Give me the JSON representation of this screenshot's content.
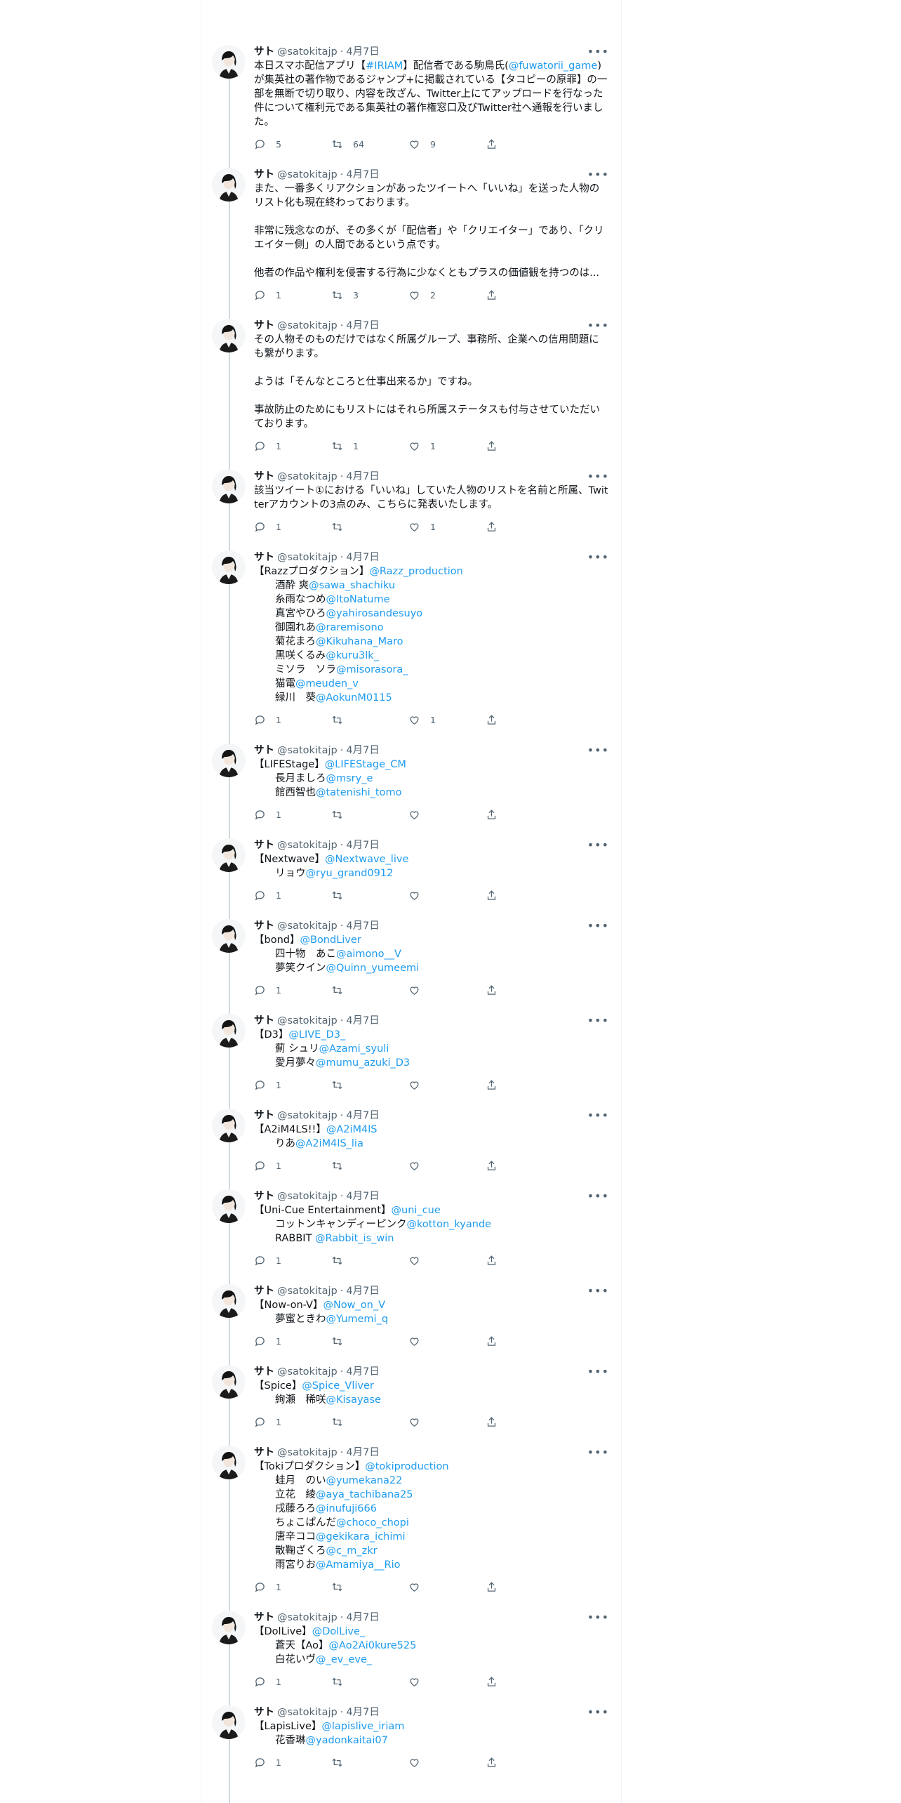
{
  "user": {
    "name": "サト",
    "handle": "@satokitajp",
    "dot": "·",
    "date": "4月7日"
  },
  "more_glyph": "•••",
  "tweets": [
    {
      "text": [
        [
          {
            "t": "本日スマホ配信アプリ【"
          },
          {
            "t": "#IRIAM",
            "link": true
          },
          {
            "t": "】配信者である駒鳥氏("
          },
          {
            "t": "@fuwatorii_game",
            "link": true
          },
          {
            "t": ")が集英社の著作物であるジャンプ+に掲載されている【タコピーの原罪】の一部を無断で切り取り、内容を改ざん、Twitter上にてアップロードを行なった件について権利元である集英社の著作権窓口及びTwitter社へ通報を行いました。"
          }
        ]
      ],
      "counts": {
        "reply": "5",
        "retweet": "64",
        "like": "9"
      }
    },
    {
      "text": [
        [
          {
            "t": "また、一番多くリアクションがあったツイートへ「いいね」を送った人物のリスト化も現在終わっております。"
          }
        ],
        [
          {
            "t": "非常に残念なのが、その多くが「配信者」や「クリエイター」であり、「クリエイター側」の人間であるという点です。"
          }
        ],
        [
          {
            "t": "他者の作品や権利を侵害する行為に少なくともプラスの価値観を持つのは..."
          }
        ]
      ],
      "counts": {
        "reply": "1",
        "retweet": "3",
        "like": "2"
      }
    },
    {
      "text": [
        [
          {
            "t": "その人物そのものだけではなく所属グループ、事務所、企業への信用問題にも繋がります。"
          }
        ],
        [
          {
            "t": "ようは「そんなところと仕事出来るか」ですね。"
          }
        ],
        [
          {
            "t": "事故防止のためにもリストにはそれら所属ステータスも付与させていただいております。"
          }
        ]
      ],
      "counts": {
        "reply": "1",
        "retweet": "1",
        "like": "1"
      }
    },
    {
      "text": [
        [
          {
            "t": "該当ツイート①における「いいね」していた人物のリストを名前と所属、Twitterアカウントの3点のみ、こちらに発表いたします。"
          }
        ]
      ],
      "counts": {
        "reply": "1",
        "retweet": "",
        "like": "1"
      }
    },
    {
      "group": {
        "label": "【Razzプロダクション】",
        "handle": "@Razz_production"
      },
      "members": [
        {
          "n": "酒酔 爽",
          "h": "@sawa_shachiku"
        },
        {
          "n": "糸雨なつめ",
          "h": "@ItoNatume"
        },
        {
          "n": "真宮やひろ",
          "h": "@yahirosandesuyo"
        },
        {
          "n": "御園れあ",
          "h": "@raremisono"
        },
        {
          "n": "菊花まろ",
          "h": "@Kikuhana_Maro"
        },
        {
          "n": "黒咲くるみ",
          "h": "@kuru3lk_"
        },
        {
          "n": "ミソラ　ソラ",
          "h": "@misorasora_"
        },
        {
          "n": "猫電",
          "h": "@meuden_v"
        },
        {
          "n": "緑川　葵",
          "h": "@AokunM0115"
        }
      ],
      "counts": {
        "reply": "1",
        "retweet": "",
        "like": "1"
      }
    },
    {
      "group": {
        "label": "【LIFEStage】",
        "handle": "@LIFEStage_CM"
      },
      "members": [
        {
          "n": "長月ましろ",
          "h": "@msry_e"
        },
        {
          "n": "館西智也",
          "h": "@tatenishi_tomo"
        }
      ],
      "counts": {
        "reply": "1",
        "retweet": "",
        "like": ""
      }
    },
    {
      "group": {
        "label": "【Nextwave】",
        "handle": "@Nextwave_live"
      },
      "members": [
        {
          "n": "リョウ",
          "h": "@ryu_grand0912"
        }
      ],
      "counts": {
        "reply": "1",
        "retweet": "",
        "like": ""
      }
    },
    {
      "group": {
        "label": "【bond】",
        "handle": "@BondLiver"
      },
      "members": [
        {
          "n": "四十物　あこ",
          "h": "@aimono__V"
        },
        {
          "n": "夢笑クイン",
          "h": "@Quinn_yumeemi"
        }
      ],
      "counts": {
        "reply": "1",
        "retweet": "",
        "like": ""
      }
    },
    {
      "group": {
        "label": "【D3】",
        "handle": "@LIVE_D3_"
      },
      "members": [
        {
          "n": "薊 シュリ",
          "h": "@Azami_syuli"
        },
        {
          "n": "愛月夢々",
          "h": "@mumu_azuki_D3"
        }
      ],
      "counts": {
        "reply": "1",
        "retweet": "",
        "like": ""
      }
    },
    {
      "group": {
        "label": "【A2iM4LS!!】",
        "handle": "@A2iM4lS"
      },
      "members": [
        {
          "n": "りあ",
          "h": "@A2iM4lS_lia"
        }
      ],
      "counts": {
        "reply": "1",
        "retweet": "",
        "like": ""
      }
    },
    {
      "group": {
        "label": "【Uni-Cue Entertainment】",
        "handle": "@uni_cue"
      },
      "members": [
        {
          "n": "コットンキャンディーピンク",
          "h": "@kotton_kyande"
        },
        {
          "n": "RABBIT ",
          "h": "@Rabbit_is_win"
        }
      ],
      "counts": {
        "reply": "1",
        "retweet": "",
        "like": ""
      }
    },
    {
      "group": {
        "label": "【Now-on-V】",
        "handle": "@Now_on_V"
      },
      "members": [
        {
          "n": "夢蜜ときわ",
          "h": "@Yumemi_q"
        }
      ],
      "counts": {
        "reply": "1",
        "retweet": "",
        "like": ""
      }
    },
    {
      "group": {
        "label": "【Spice】",
        "handle": "@Spice_Vliver"
      },
      "members": [
        {
          "n": "絢瀬　稀咲",
          "h": "@Kisayase"
        }
      ],
      "counts": {
        "reply": "1",
        "retweet": "",
        "like": ""
      }
    },
    {
      "group": {
        "label": "【Tokiプロダクション】",
        "handle": "@tokiproduction"
      },
      "members": [
        {
          "n": "蛙月　のい",
          "h": "@yumekana22"
        },
        {
          "n": "立花　綾",
          "h": "@aya_tachibana25"
        },
        {
          "n": "戌藤ろろ",
          "h": "@inufuji666"
        },
        {
          "n": "ちょこぱんだ",
          "h": "@choco_chopi"
        },
        {
          "n": "唐辛ココ",
          "h": "@gekikara_ichimi"
        },
        {
          "n": "散鞠ざくろ",
          "h": "@c_m_zkr"
        },
        {
          "n": "雨宮りお",
          "h": "@Amamiya__Rio"
        }
      ],
      "counts": {
        "reply": "1",
        "retweet": "",
        "like": ""
      }
    },
    {
      "group": {
        "label": "【DolLive】",
        "handle": "@DolLive_"
      },
      "members": [
        {
          "n": "蒼天【Ao】",
          "h": "@Ao2Ai0kure525"
        },
        {
          "n": "白花いヴ",
          "h": "@_ev_eve_"
        }
      ],
      "counts": {
        "reply": "1",
        "retweet": "",
        "like": ""
      }
    },
    {
      "group": {
        "label": "【LapisLive】",
        "handle": "@lapislive_iriam"
      },
      "members": [
        {
          "n": "花香琳",
          "h": "@yadonkaitai07"
        }
      ],
      "counts": {
        "reply": "1",
        "retweet": "",
        "like": ""
      }
    }
  ],
  "icons": [
    "reply-icon",
    "retweet-icon",
    "like-icon",
    "share-icon",
    "more-icon",
    "avatar"
  ],
  "colors": {
    "link": "#1d9bf0",
    "muted": "#536471",
    "text": "#0f1419",
    "thread_line": "#cfd9de"
  }
}
